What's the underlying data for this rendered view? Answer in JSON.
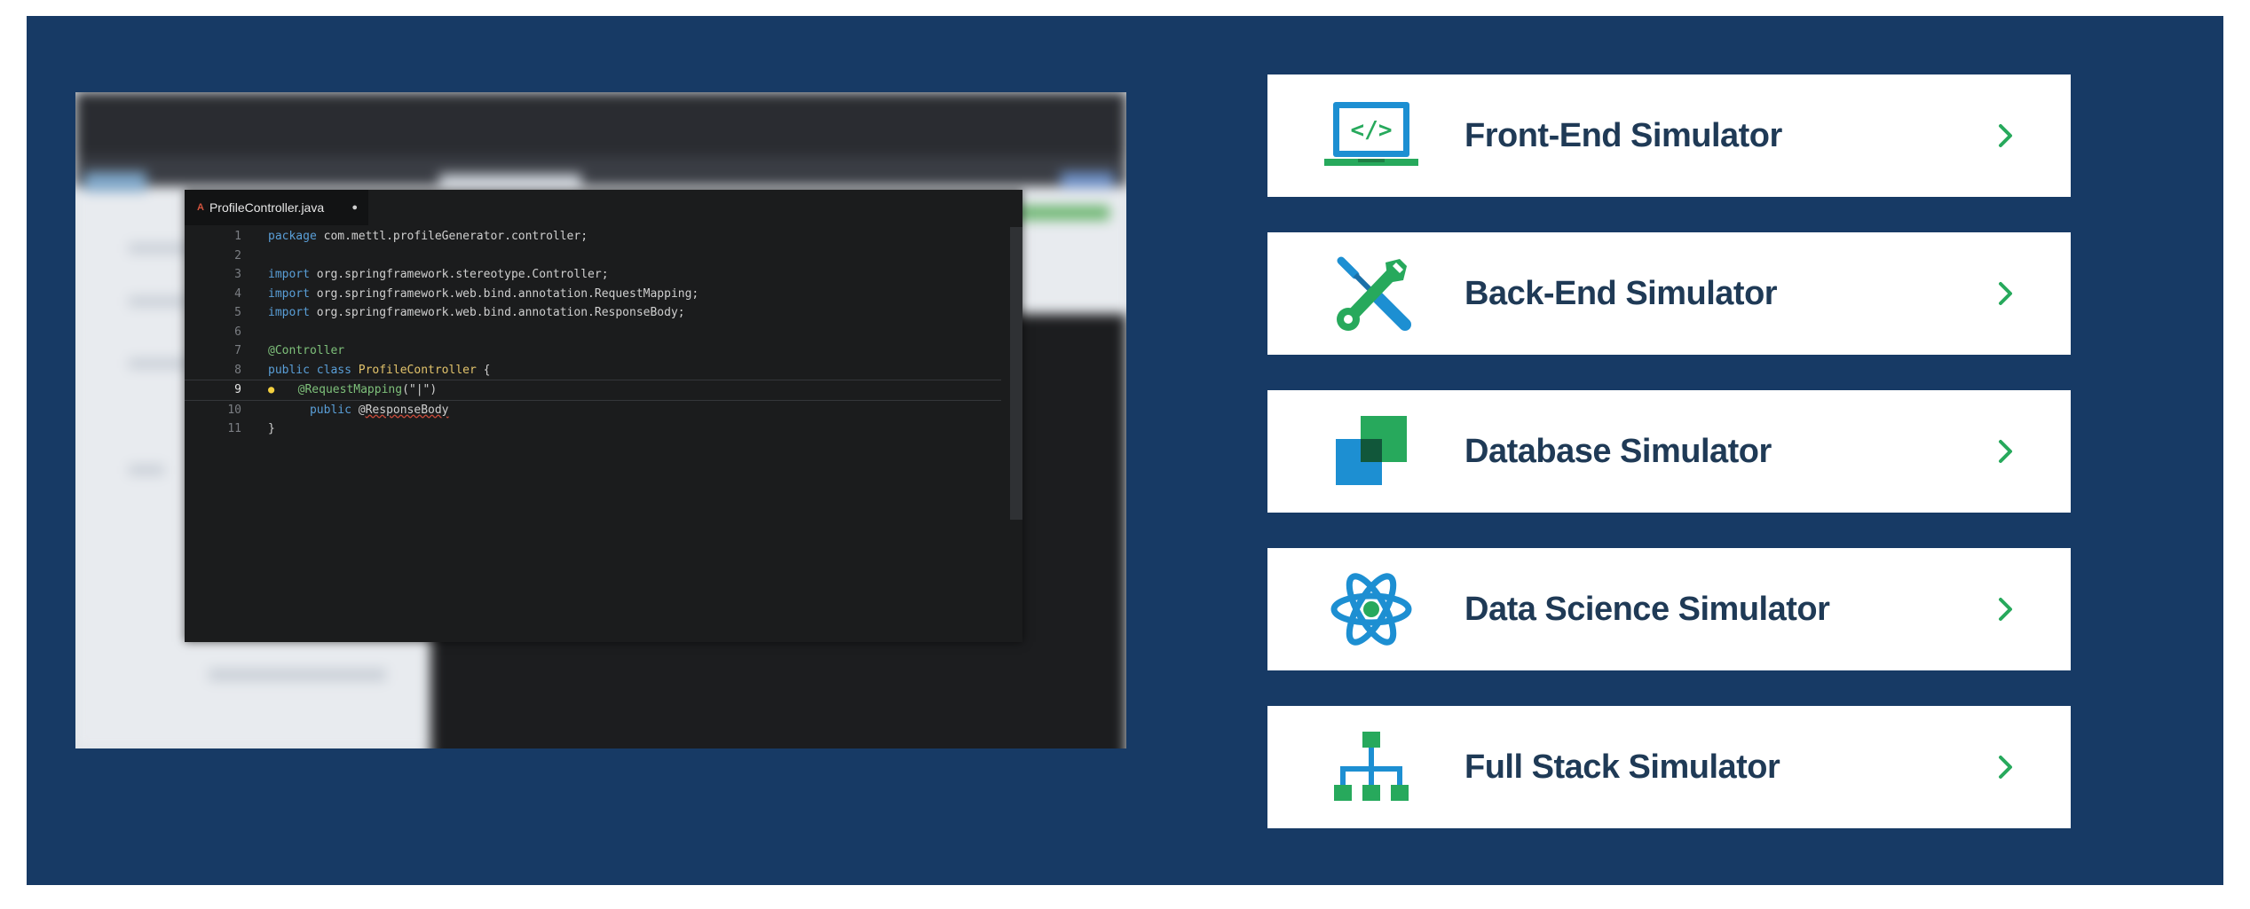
{
  "editor": {
    "tab_name": "ProfileController.java",
    "tab_icon_text": "A",
    "tab_dot": "●",
    "lines": [
      {
        "n": "1",
        "parts": [
          [
            "kw",
            "package"
          ],
          [
            "t",
            " com.mettl.profileGenerator.controller;"
          ]
        ]
      },
      {
        "n": "2",
        "parts": []
      },
      {
        "n": "3",
        "parts": [
          [
            "kw",
            "import"
          ],
          [
            "t",
            " org.springframework.stereotype.Controller;"
          ]
        ]
      },
      {
        "n": "4",
        "parts": [
          [
            "kw",
            "import"
          ],
          [
            "t",
            " org.springframework.web.bind.annotation.RequestMapping;"
          ]
        ]
      },
      {
        "n": "5",
        "parts": [
          [
            "kw",
            "import"
          ],
          [
            "t",
            " org.springframework.web.bind.annotation.ResponseBody;"
          ]
        ]
      },
      {
        "n": "6",
        "parts": []
      },
      {
        "n": "7",
        "parts": [
          [
            "ann",
            "@Controller"
          ]
        ]
      },
      {
        "n": "8",
        "parts": [
          [
            "kw",
            "public class "
          ],
          [
            "cls",
            "ProfileController"
          ],
          [
            "t",
            " {"
          ]
        ]
      },
      {
        "n": "9",
        "current": true,
        "bulb": true,
        "parts": [
          [
            "t",
            "  "
          ],
          [
            "ann",
            "@RequestMapping"
          ],
          [
            "t",
            "(\"|\")"
          ]
        ]
      },
      {
        "n": "10",
        "parts": [
          [
            "t",
            "      "
          ],
          [
            "kw",
            "public"
          ],
          [
            "t",
            " @"
          ],
          [
            "sq",
            "ResponseBody"
          ]
        ]
      },
      {
        "n": "11",
        "parts": [
          [
            "t",
            "}"
          ]
        ]
      }
    ]
  },
  "simulators": [
    {
      "label": "Front-End Simulator",
      "icon": "laptop-code-icon"
    },
    {
      "label": "Back-End Simulator",
      "icon": "tools-icon"
    },
    {
      "label": "Database Simulator",
      "icon": "database-squares-icon"
    },
    {
      "label": "Data Science Simulator",
      "icon": "atom-icon"
    },
    {
      "label": "Full Stack Simulator",
      "icon": "hierarchy-icon"
    }
  ],
  "colors": {
    "panel": "#173a65",
    "accent_green": "#27a95c",
    "accent_blue": "#1d8fd2",
    "label": "#1f3a56"
  }
}
